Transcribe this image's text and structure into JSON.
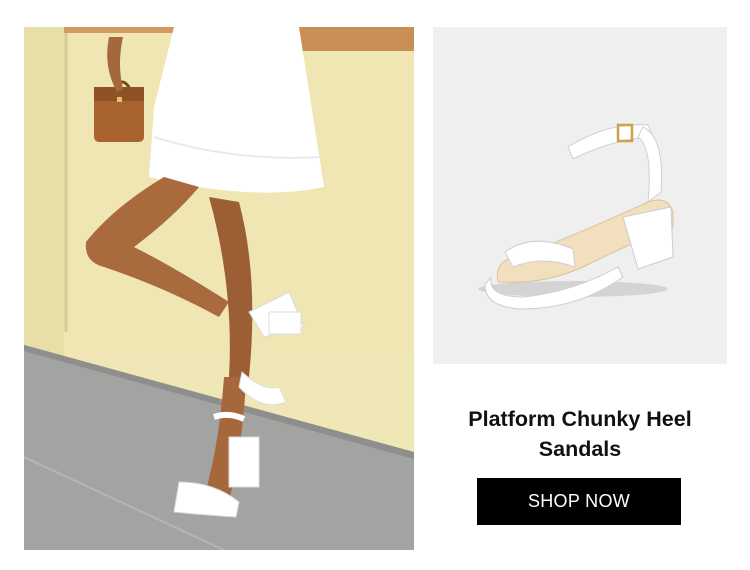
{
  "product": {
    "title": "Platform Chunky Heel Sandals"
  },
  "cta": {
    "label": "SHOP NOW"
  },
  "colors": {
    "button_bg": "#000000",
    "button_text": "#ffffff",
    "wall": "#efe7b6",
    "pavement": "#9b9b99",
    "product_bg": "#efefef"
  },
  "images": {
    "lifestyle": "lifestyle-photo",
    "product": "product-photo"
  }
}
